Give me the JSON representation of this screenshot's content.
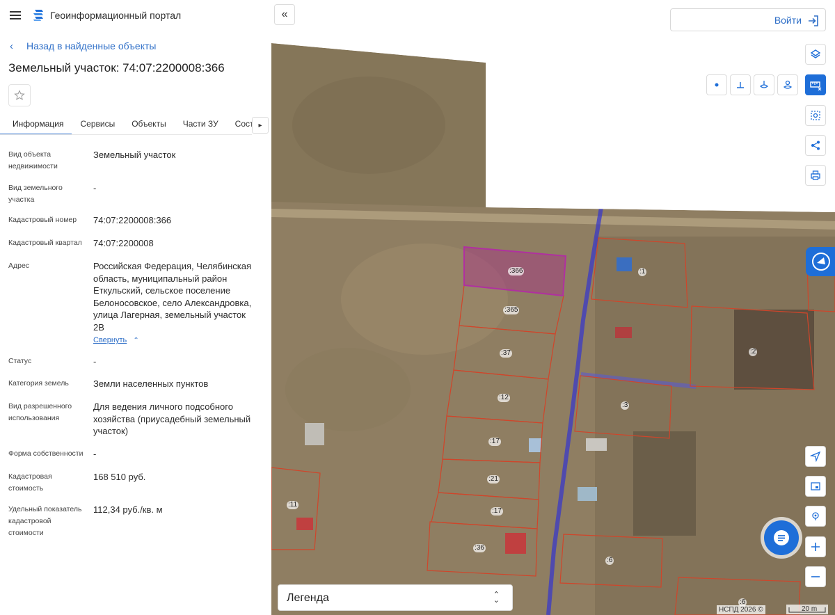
{
  "header": {
    "app_title": "Геоинформационный портал"
  },
  "nav": {
    "back_label": "Назад в найденные объекты"
  },
  "object": {
    "title": "Земельный участок: 74:07:2200008:366"
  },
  "tabs": [
    {
      "label": "Информация",
      "active": true
    },
    {
      "label": "Сервисы",
      "active": false
    },
    {
      "label": "Объекты",
      "active": false
    },
    {
      "label": "Части ЗУ",
      "active": false
    },
    {
      "label": "Состав",
      "active": false
    }
  ],
  "info": {
    "rows": [
      {
        "label": "Вид объекта недвижимости",
        "value": "Земельный участок"
      },
      {
        "label": "Вид земельного участка",
        "value": "-"
      },
      {
        "label": "Кадастровый номер",
        "value": "74:07:2200008:366"
      },
      {
        "label": "Кадастровый квартал",
        "value": "74:07:2200008"
      },
      {
        "label": "Адрес",
        "value": "Российская Федерация, Челябинская область, муниципальный район Еткульский, сельское поселение Белоносовское, село Александровка, улица Лагерная, земельный участок 2В"
      },
      {
        "label": "Статус",
        "value": "-"
      },
      {
        "label": "Категория земель",
        "value": "Земли населенных пунктов"
      },
      {
        "label": "Вид разрешенного использования",
        "value": "Для ведения личного подсобного хозяйства (приусадебный земельный участок)"
      },
      {
        "label": "Форма собственности",
        "value": "-"
      },
      {
        "label": "Кадастровая стоимость",
        "value": "168 510 руб."
      },
      {
        "label": "Удельный показатель кадастровой стоимости",
        "value": "112,34 руб./кв. м"
      }
    ],
    "collapse_label": "Свернуть"
  },
  "map": {
    "login_label": "Войти",
    "legend_label": "Легенда",
    "attribution": "НСПД 2026 ©",
    "scale_label": "20 m",
    "plot_labels": [
      ":366",
      ":365",
      ":37",
      ":12",
      ":17",
      ":21",
      ":17",
      ":36",
      ":11",
      ":1",
      ":2",
      ":3",
      ":6",
      ":6"
    ]
  },
  "colors": {
    "accent": "#1e6ed8",
    "link": "#3070c8",
    "selected_plot": "#a8308a",
    "plot_border": "#d0452a",
    "road_line": "#3a3ac8"
  }
}
